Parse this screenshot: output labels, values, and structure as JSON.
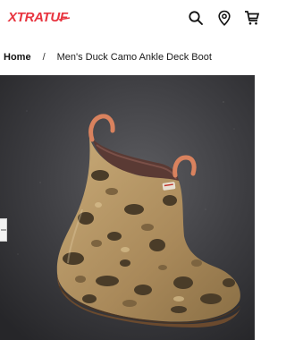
{
  "header": {
    "logo_text": "XTRATUF",
    "icons": [
      "search-icon",
      "location-icon",
      "cart-icon"
    ],
    "brand_color": "#e8343f"
  },
  "breadcrumb": {
    "home": "Home",
    "separator": "/",
    "current": "Men's Duck Camo Ankle Deck Boot"
  },
  "product_image": {
    "subject": "duck camo ankle deck boot",
    "colors": {
      "camo_base": "#b89968",
      "camo_dark": "#4a3c28",
      "camo_mid": "#8a6f45",
      "pull_tab": "#d9825e",
      "sole": "#6b4a2e"
    }
  }
}
